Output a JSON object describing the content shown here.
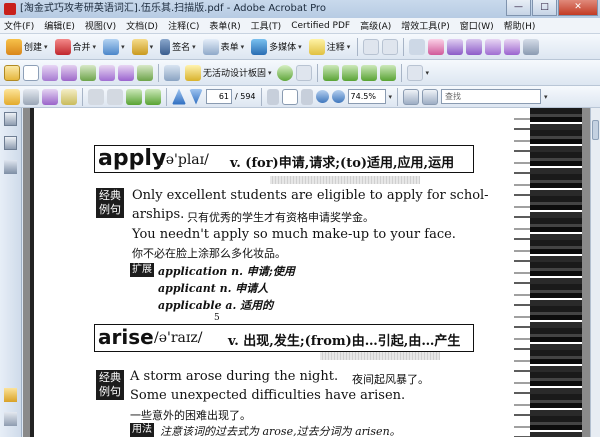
{
  "window": {
    "title": "[淘金式巧攻考研英语词汇].伍乐其.扫描版.pdf - Adobe Acrobat Pro",
    "minimize": "—",
    "maximize": "□",
    "close": "✕"
  },
  "menu": [
    "文件(F)",
    "编辑(E)",
    "视图(V)",
    "文档(D)",
    "注释(C)",
    "表单(R)",
    "工具(T)",
    "Certified PDF",
    "高级(A)",
    "增效工具(P)",
    "窗口(W)",
    "帮助(H)"
  ],
  "toolbar1": {
    "create": "创建",
    "combine": "合并",
    "sign": "签名",
    "form": "表单",
    "multimedia": "多媒体",
    "comment": "注释"
  },
  "toolbar2": {
    "design": "无活动设计板固"
  },
  "toolbar3": {
    "page_current": "61",
    "page_total": "/ 594",
    "zoom": "74.5%",
    "search_placeholder": "查找"
  },
  "page": {
    "apply": {
      "word": "apply",
      "phonetic": "/ə'plaɪ/",
      "definition": "v. (for)申请,请求;(to)适用,应用,运用",
      "tag": "经典\n例句",
      "s1_a": "Only excellent students are eligible to apply for schol-",
      "s1_b": "arships.",
      "s1_cn": "只有优秀的学生才有资格申请奖学金。",
      "s2": "You needn't apply so much make-up to your face.",
      "s2_cn": "你不必在脸上涂那么多化妆品。",
      "ext_tag": "扩展",
      "ext1": "application n. 申请;使用",
      "ext2": "applicant n. 申请人",
      "ext3": "applicable a. 适用的"
    },
    "arise": {
      "word": "arise",
      "phonetic": "/ə'raɪz/",
      "definition": "v. 出现,发生;(from)由…引起,由…产生",
      "tag": "经典\n例句",
      "s1": "A storm arose during the night.",
      "s1_cn": "夜间起风暴了。",
      "s2": "Some unexpected difficulties have arisen.",
      "s2_cn": "一些意外的困难出现了。",
      "use_tag": "用法",
      "use": "注意该词的过去式为 arose,过去分词为 arisen。"
    },
    "folio": "5"
  }
}
